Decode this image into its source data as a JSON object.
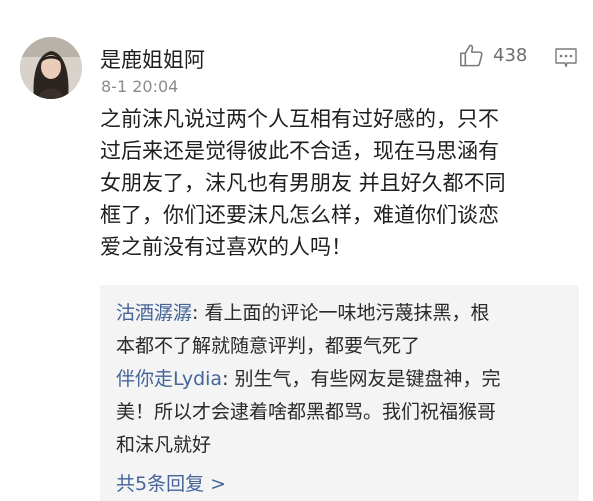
{
  "comment": {
    "username": "是鹿姐姐阿",
    "timestamp": "8-1 20:04",
    "like_count": "438",
    "icons": {
      "avatar": "user-avatar-photo",
      "like": "thumbs-up-icon",
      "more": "more-dots-icon"
    },
    "body_lines": [
      "之前沫凡说过两个人互相有过好感的，只不",
      "过后来还是觉得彼此不合适，现在马思涵有",
      "女朋友了，沫凡也有男朋友 并且好久都不同",
      "框了，你们还要沫凡怎么样，难道你们谈恋",
      "爱之前没有过喜欢的人吗！"
    ]
  },
  "replies": [
    {
      "author": "沽酒潺潺",
      "line1": ": 看上面的评论一味地污蔑抹黑，根",
      "line2": "本都不了解就随意评判，都要气死了"
    },
    {
      "author": "伴你走Lydia",
      "line1": ": 别生气，有些网友是键盘神，完",
      "line2": "美！所以才会逮着啥都黑都骂。我们祝福猴哥",
      "line3": "和沫凡就好"
    }
  ],
  "more_replies_label": "共5条回复 >",
  "colors": {
    "link": "#44649a",
    "text": "#1f1f1f",
    "muted": "#8c8c8c",
    "reply_bg": "#f4f4f4"
  }
}
